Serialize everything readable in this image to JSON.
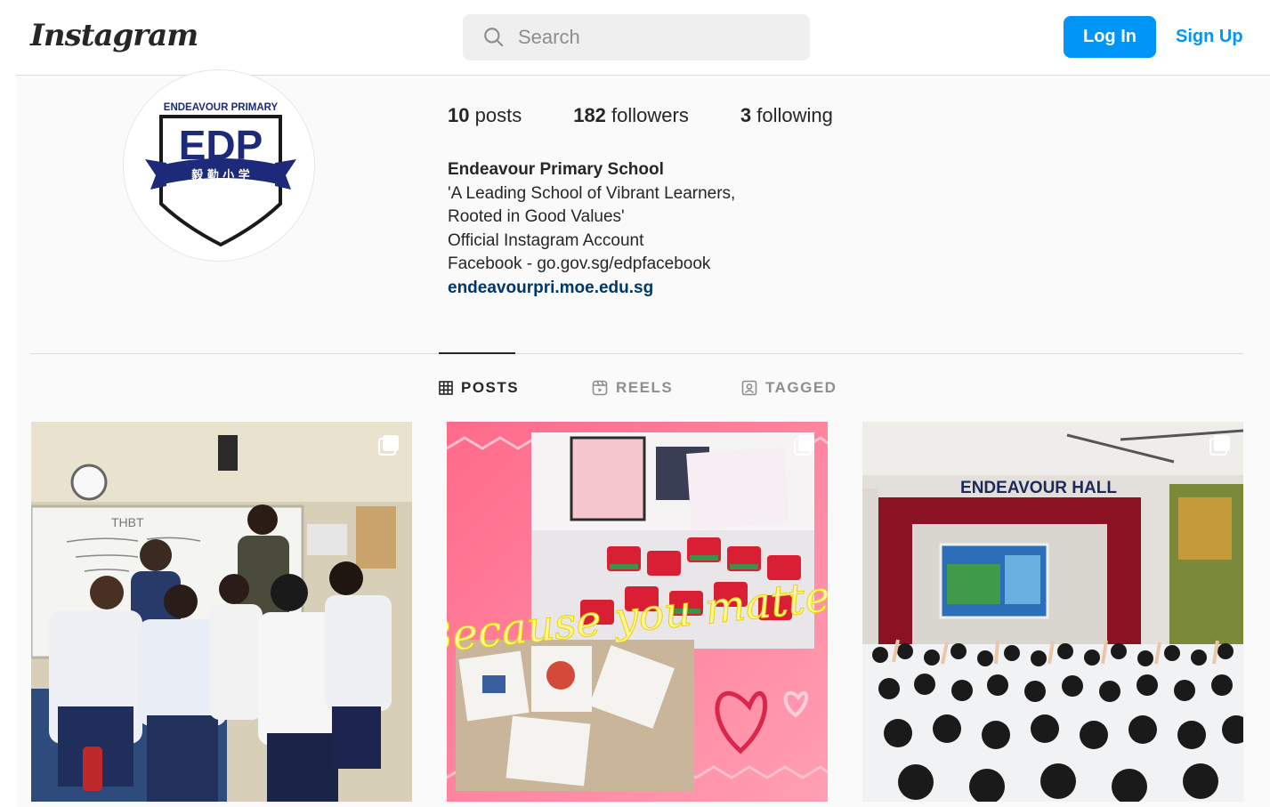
{
  "header": {
    "logo_text": "Instagram",
    "search_placeholder": "Search",
    "login_label": "Log In",
    "signup_label": "Sign Up"
  },
  "profile": {
    "avatar": {
      "top_text": "ENDEAVOUR PRIMARY",
      "main_text": "EDP",
      "ribbon_text": "毅 勤 小 学"
    },
    "stats": [
      {
        "count": "10",
        "label": "posts"
      },
      {
        "count": "182",
        "label": "followers"
      },
      {
        "count": "3",
        "label": "following"
      }
    ],
    "name": "Endeavour Primary School",
    "bio_lines": [
      "'A Leading School of Vibrant Learners,",
      "Rooted in Good Values'",
      "Official Instagram Account",
      "Facebook - go.gov.sg/edpfacebook"
    ],
    "website": "endeavourpri.moe.edu.sg"
  },
  "tabs": [
    {
      "label": "POSTS",
      "icon": "grid-icon",
      "active": true
    },
    {
      "label": "REELS",
      "icon": "reels-icon",
      "active": false
    },
    {
      "label": "TAGGED",
      "icon": "tagged-icon",
      "active": false
    }
  ],
  "posts": [
    {
      "alt": "Students posing in classroom",
      "whiteboard_text": "THBT",
      "multi": true
    },
    {
      "alt": "Valentine's Day cakes",
      "overlay_text": "Because you matter",
      "multi": true
    },
    {
      "alt": "Students in Endeavour Hall",
      "banner_text": "ENDEAVOUR HALL",
      "multi": true
    }
  ],
  "colors": {
    "accent": "#0095f6",
    "link": "#00376b",
    "text": "#262626",
    "muted": "#8e8e8e"
  }
}
